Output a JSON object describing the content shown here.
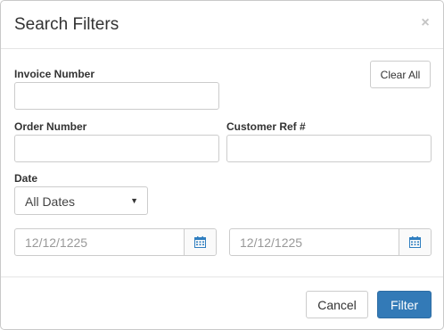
{
  "header": {
    "title": "Search Filters",
    "close_symbol": "×"
  },
  "form": {
    "clear_all_label": "Clear All",
    "invoice_number": {
      "label": "Invoice Number",
      "value": ""
    },
    "order_number": {
      "label": "Order Number",
      "value": ""
    },
    "customer_ref": {
      "label": "Customer Ref #",
      "value": ""
    },
    "date": {
      "label": "Date",
      "selected": "All Dates",
      "caret": "▼",
      "from": "12/12/1225",
      "to": "12/12/1225",
      "icon": "calendar-icon"
    }
  },
  "footer": {
    "cancel_label": "Cancel",
    "filter_label": "Filter"
  },
  "colors": {
    "primary": "#337ab7",
    "calendar_icon": "#2f7ec0"
  }
}
